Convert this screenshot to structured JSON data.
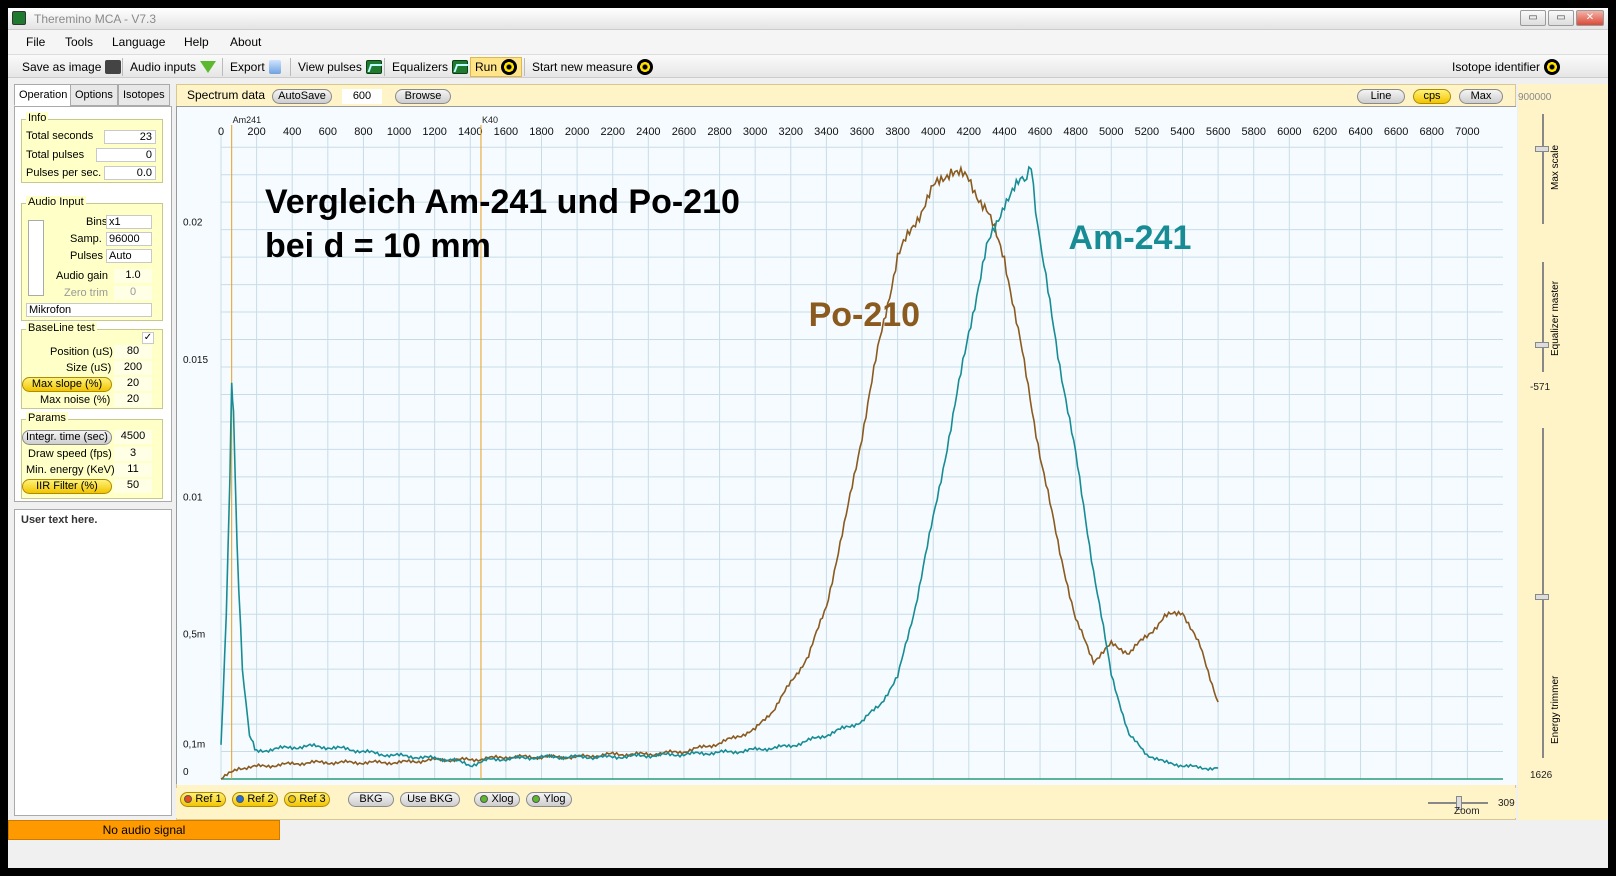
{
  "window": {
    "title": "Theremino MCA - V7.3",
    "min": "▭",
    "max": "▭",
    "close": "✕"
  },
  "menu": [
    "File",
    "Tools",
    "Language",
    "Help",
    "About"
  ],
  "toolbar": {
    "save_as_image": "Save as image",
    "audio_inputs": "Audio inputs",
    "export": "Export",
    "view_pulses": "View pulses",
    "equalizers": "Equalizers",
    "run": "Run",
    "start_new_measure": "Start new measure",
    "isotope_identifier": "Isotope identifier"
  },
  "tabs": [
    "Operation",
    "Options",
    "Isotopes"
  ],
  "info": {
    "title": "Info",
    "total_seconds_label": "Total seconds",
    "total_seconds": "23",
    "total_pulses_label": "Total pulses",
    "total_pulses": "0",
    "pulses_per_sec_label": "Pulses per sec.",
    "pulses_per_sec": "0.0"
  },
  "audio_input": {
    "title": "Audio Input",
    "bins_label": "Bins",
    "bins": "x1",
    "samp_label": "Samp.",
    "samp": "96000",
    "pulses_label": "Pulses",
    "pulses": "Auto",
    "gain_label": "Audio gain",
    "gain": "1.0",
    "zero_trim_label": "Zero trim",
    "zero_trim": "0",
    "device": "Mikrofon"
  },
  "baseline": {
    "title": "BaseLine test",
    "checkbox": "✓",
    "position_label": "Position (uS)",
    "position": "80",
    "size_label": "Size (uS)",
    "size": "200",
    "max_slope_label": "Max slope (%)",
    "max_slope": "20",
    "max_noise_label": "Max noise (%)",
    "max_noise": "20"
  },
  "params": {
    "title": "Params",
    "integr_label": "Integr. time (sec)",
    "integr": "4500",
    "draw_speed_label": "Draw speed (fps)",
    "draw_speed": "3",
    "min_energy_label": "Min. energy (KeV)",
    "min_energy": "11",
    "iir_label": "IIR Filter (%)",
    "iir": "50"
  },
  "user_text": "User text here.",
  "status": "No audio signal",
  "spectrum": {
    "label": "Spectrum data",
    "autosave": "AutoSave",
    "autosave_value": "600",
    "browse": "Browse",
    "line": "Line",
    "cps": "cps",
    "max": "Max",
    "max_value": "900000"
  },
  "bottom_buttons": {
    "ref1": "Ref 1",
    "ref2": "Ref 2",
    "ref3": "Ref 3",
    "bkg": "BKG",
    "use_bkg": "Use BKG",
    "xlog": "Xlog",
    "ylog": "Ylog"
  },
  "right_panel": {
    "max_scale": "Max scale",
    "equalizer_master": "Equalizer master",
    "eq_value": "-571",
    "energy_trimmer": "Energy trimmer",
    "energy_value": "1626",
    "zoom": "Zoom",
    "zoom_value": "309"
  },
  "colors": {
    "po210": "#8a5a1e",
    "am241": "#178c94",
    "marker": "#e8a020",
    "grid": "#c8dce8"
  },
  "chart_data": {
    "type": "line",
    "title": "Vergleich Am-241 und Po-210",
    "subtitle": "bei d = 10 mm",
    "x_ticks": [
      "0",
      "200",
      "400",
      "600",
      "800",
      "1000",
      "1200",
      "1400",
      "1600",
      "1800",
      "2000",
      "2200",
      "2400",
      "2600",
      "2800",
      "3000",
      "3200",
      "3400",
      "3600",
      "3800",
      "4000",
      "4200",
      "4400",
      "4600",
      "4800",
      "5000",
      "5200",
      "5400",
      "5600",
      "5800",
      "6000",
      "6200",
      "6400",
      "6600",
      "6800",
      "7000"
    ],
    "y_tick_labels": [
      {
        "label": "0.02",
        "value": 0.02
      },
      {
        "label": "0.015",
        "value": 0.015
      },
      {
        "label": "0.01",
        "value": 0.01
      },
      {
        "label": "0,5m",
        "value": 0.005
      },
      {
        "label": "0,1m",
        "value": 0.001
      },
      {
        "label": "0",
        "value": 0
      }
    ],
    "xlim": [
      0,
      7200
    ],
    "ylim": [
      0,
      0.0233
    ],
    "markers": [
      {
        "label": "Am241",
        "x": 60
      },
      {
        "label": "K40",
        "x": 1460
      }
    ],
    "series": [
      {
        "name": "Po-210",
        "x": [
          0,
          100,
          300,
          500,
          800,
          1000,
          1200,
          1400,
          1600,
          1800,
          2000,
          2200,
          2400,
          2600,
          2800,
          3000,
          3100,
          3200,
          3300,
          3400,
          3500,
          3600,
          3700,
          3800,
          3900,
          4000,
          4100,
          4200,
          4300,
          4400,
          4500,
          4600,
          4700,
          4800,
          4900,
          5000,
          5100,
          5200,
          5300,
          5400,
          5500,
          5600
        ],
        "values": [
          0,
          0.0004,
          0.0005,
          0.0006,
          0.0006,
          0.0006,
          0.0007,
          0.0007,
          0.0008,
          0.0008,
          0.0008,
          0.0009,
          0.0009,
          0.001,
          0.0013,
          0.0018,
          0.0025,
          0.0035,
          0.0045,
          0.0063,
          0.0092,
          0.0125,
          0.016,
          0.019,
          0.0203,
          0.0215,
          0.0222,
          0.0218,
          0.0207,
          0.019,
          0.0155,
          0.0118,
          0.0086,
          0.0058,
          0.0043,
          0.0049,
          0.0046,
          0.0052,
          0.0059,
          0.0061,
          0.0048,
          0.0028
        ]
      },
      {
        "name": "Am-241",
        "x": [
          0,
          30,
          50,
          60,
          70,
          90,
          120,
          160,
          200,
          300,
          500,
          700,
          900,
          1100,
          1300,
          1400,
          1500,
          1800,
          2200,
          2600,
          2900,
          3200,
          3400,
          3600,
          3700,
          3800,
          3900,
          4000,
          4100,
          4200,
          4300,
          4400,
          4500,
          4550,
          4600,
          4700,
          4800,
          4900,
          5000,
          5100,
          5200,
          5300,
          5400,
          5500,
          5600
        ],
        "values": [
          0.0012,
          0.006,
          0.011,
          0.0143,
          0.0135,
          0.0085,
          0.004,
          0.0016,
          0.001,
          0.0011,
          0.0012,
          0.0011,
          0.0009,
          0.0008,
          0.0007,
          0.0005,
          0.0007,
          0.0008,
          0.0008,
          0.0009,
          0.001,
          0.0012,
          0.0016,
          0.0021,
          0.0027,
          0.0037,
          0.0063,
          0.0095,
          0.0128,
          0.0163,
          0.0193,
          0.021,
          0.0218,
          0.0222,
          0.0195,
          0.0155,
          0.0118,
          0.0076,
          0.0038,
          0.0016,
          0.0009,
          0.0006,
          0.0005,
          0.0004,
          0.0004
        ]
      }
    ],
    "annotations": [
      {
        "text": "Po-210",
        "x": 3300,
        "y": 0.0165
      },
      {
        "text": "Am-241",
        "x": 4760,
        "y": 0.0193
      }
    ]
  }
}
